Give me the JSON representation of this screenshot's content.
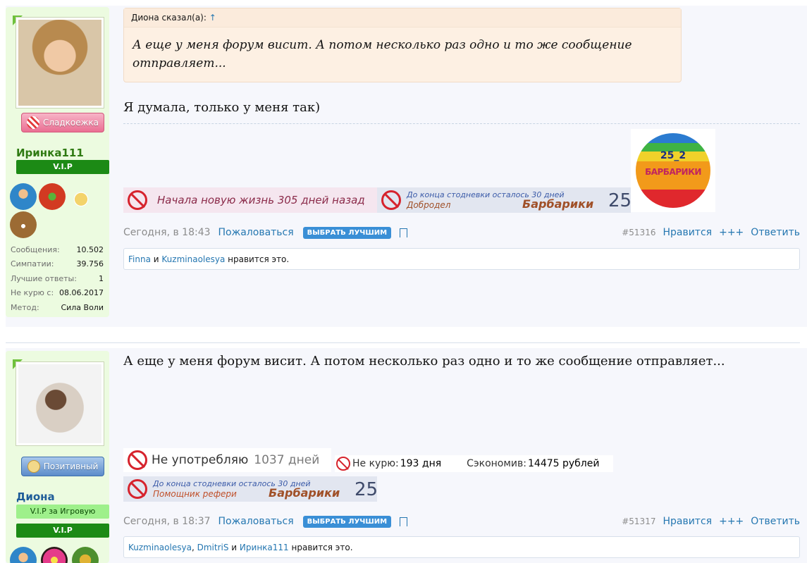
{
  "post1": {
    "quote_author": "Диона сказал(а):",
    "quote_arrow": "↑",
    "quote_text_line1": "А еще у меня форум висит. А потом несколько раз одно и то же сообщение",
    "quote_text_line2": "отправляет...",
    "message": "Я думала, только у меня так)",
    "sig1": "Начала новую жизнь 305 дней назад",
    "sig2_line1": "До конца стодневки осталось 30 дней",
    "sig2_line2": "Добродел",
    "sig2_brand": "Барбарики",
    "sig2_num": "25",
    "logo_num": "25_2",
    "logo_text": "БАРБАРИКИ",
    "time": "Сегодня, в 18:43",
    "report": "Пожаловаться",
    "best": "ВЫБРАТЬ ЛУЧШИМ",
    "post_num": "#51316",
    "like": "Нравится",
    "plus": "+++",
    "reply": "Ответить",
    "likes_user1": "Finna",
    "likes_and": "и",
    "likes_user2": "Kuzminaolesya",
    "likes_tail": "нравится это.",
    "user": {
      "rank": "Сладкоежка",
      "name": "Иринка111",
      "badge": "V.I.P",
      "stats": [
        {
          "k": "Сообщения:",
          "v": "10.502"
        },
        {
          "k": "Симпатии:",
          "v": "39.756"
        },
        {
          "k": "Лучшие ответы:",
          "v": "1"
        },
        {
          "k": "Не курю с:",
          "v": "08.06.2017"
        },
        {
          "k": "Метод:",
          "v": "Сила Воли"
        }
      ]
    }
  },
  "post2": {
    "message": "А еще у меня форум висит. А потом несколько раз одно и то же сообщение отправляет...",
    "sig1_label": "Не употребляю",
    "sig1_value": "1037 дней",
    "sig2_label": "Не курю:",
    "sig2_value": "193 дня",
    "sig2_saved_label": "Сэкономив:",
    "sig2_saved_value": "14475 рублей",
    "sig3_line1": "До конца стодневки осталось 30 дней",
    "sig3_line2": "Помощник рефери",
    "sig3_brand": "Барбарики",
    "sig3_num": "25",
    "time": "Сегодня, в 18:37",
    "report": "Пожаловаться",
    "best": "ВЫБРАТЬ ЛУЧШИМ",
    "post_num": "#51317",
    "like": "Нравится",
    "plus": "+++",
    "reply": "Ответить",
    "likes_user1": "Kuzminaolesya",
    "likes_comma": ",",
    "likes_user2": "DmitriS",
    "likes_and": "и",
    "likes_user3": "Иринка111",
    "likes_tail": "нравится это.",
    "user": {
      "rank": "Позитивный",
      "name": "Диона",
      "badge1": "V.I.P за Игровую",
      "badge2": "V.I.P"
    }
  }
}
